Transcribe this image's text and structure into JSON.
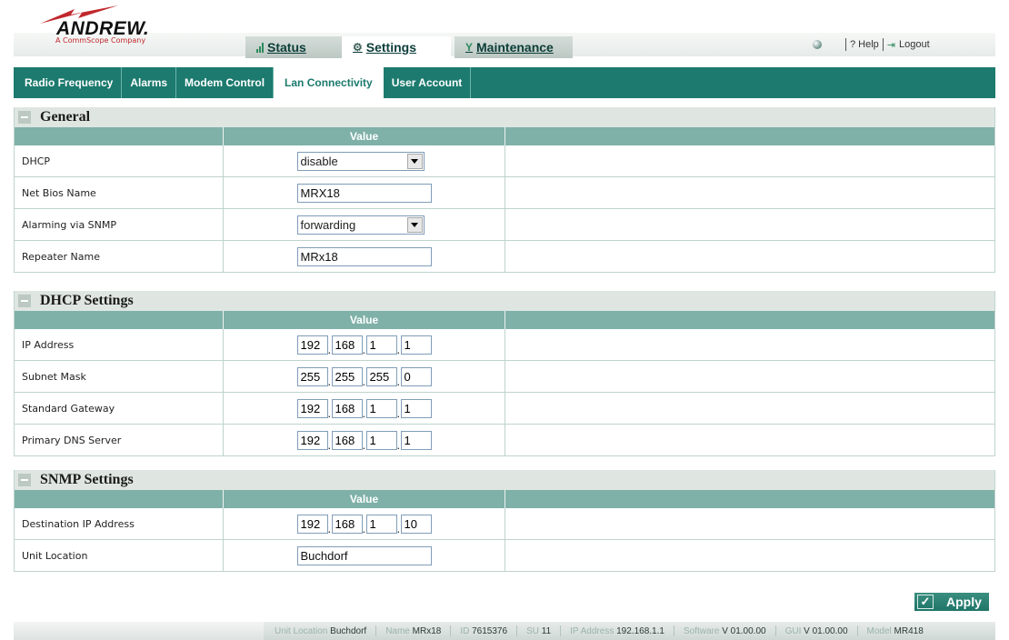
{
  "header": {
    "logo_text": "ANDREW.",
    "logo_sub": "A CommScope Company",
    "tabs": [
      {
        "label": "Status",
        "icon": "signal-bars-icon"
      },
      {
        "label": "Settings",
        "icon": "gears-icon"
      },
      {
        "label": "Maintenance",
        "icon": "tools-icon"
      }
    ],
    "active_tab": "Settings",
    "help_label": "? Help",
    "logout_label": "Logout"
  },
  "subtabs": [
    "Radio Frequency",
    "Alarms",
    "Modem Control",
    "Lan Connectivity",
    "User Account"
  ],
  "active_subtab": "Lan Connectivity",
  "columns": {
    "value": "Value"
  },
  "general": {
    "title": "General",
    "dhcp": {
      "label": "DHCP",
      "value": "disable"
    },
    "netbios": {
      "label": "Net Bios Name",
      "value": "MRX18"
    },
    "snmp_alarming": {
      "label": "Alarming via SNMP",
      "value": "forwarding"
    },
    "repeater": {
      "label": "Repeater Name",
      "value": "MRx18"
    }
  },
  "dhcp_settings": {
    "title": "DHCP Settings",
    "ip": {
      "label": "IP Address",
      "octets": [
        "192",
        "168",
        "1",
        "1"
      ]
    },
    "mask": {
      "label": "Subnet Mask",
      "octets": [
        "255",
        "255",
        "255",
        "0"
      ]
    },
    "gateway": {
      "label": "Standard Gateway",
      "octets": [
        "192",
        "168",
        "1",
        "1"
      ]
    },
    "dns": {
      "label": "Primary DNS Server",
      "octets": [
        "192",
        "168",
        "1",
        "1"
      ]
    }
  },
  "snmp_settings": {
    "title": "SNMP Settings",
    "dest_ip": {
      "label": "Destination IP Address",
      "octets": [
        "192",
        "168",
        "1",
        "10"
      ]
    },
    "location": {
      "label": "Unit Location",
      "value": "Buchdorf"
    }
  },
  "apply_label": "Apply",
  "footer": {
    "unit_location_k": "Unit Location",
    "unit_location_v": "Buchdorf",
    "name_k": "Name",
    "name_v": "MRx18",
    "id_k": "ID",
    "id_v": "7615376",
    "su_k": "SU",
    "su_v": "11",
    "ip_k": "IP Address",
    "ip_v": "192.168.1.1",
    "sw_k": "Software",
    "sw_v": "V 01.00.00",
    "gui_k": "GUI",
    "gui_v": "V 01.00.00",
    "model_k": "Model",
    "model_v": "MR418"
  },
  "colors": {
    "accent": "#1c7a6e",
    "column_header": "#7fb1a8",
    "section_header": "#dfe6e2"
  }
}
